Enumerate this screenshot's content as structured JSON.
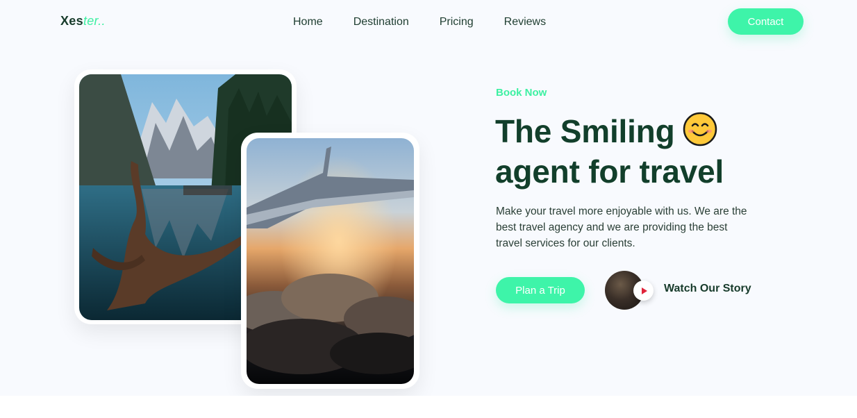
{
  "brand": {
    "name_main": "Xes",
    "name_accent": "ter.."
  },
  "nav": {
    "items": [
      "Home",
      "Destination",
      "Pricing",
      "Reviews"
    ]
  },
  "header": {
    "contact_label": "Contact"
  },
  "hero": {
    "kicker": "Book Now",
    "headline_line1": "The Smiling",
    "headline_line2": "agent for travel",
    "description": "Make your travel more enjoyable with us. We are the best travel agency and we are providing the best travel services for our clients.",
    "cta_label": "Plan a Trip",
    "story_label": "Watch Our Story"
  },
  "colors": {
    "accent": "#3ef4a9",
    "heading": "#123f2b",
    "play": "#e0243a",
    "background": "#f8fafe"
  },
  "icons": {
    "emoji": "smiling-face-icon",
    "play": "play-icon"
  }
}
